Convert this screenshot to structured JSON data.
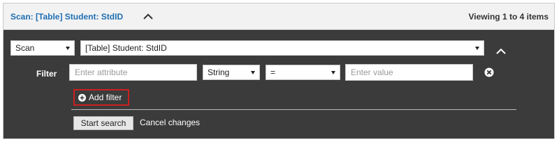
{
  "header": {
    "title": "Scan: [Table] Student: StdID",
    "viewing": "Viewing 1 to 4 items"
  },
  "query": {
    "mode": "Scan",
    "source": "[Table] Student: StdID"
  },
  "filter": {
    "label": "Filter",
    "attribute_placeholder": "Enter attribute",
    "type": "String",
    "operator": "=",
    "value_placeholder": "Enter value"
  },
  "actions": {
    "add_filter": "Add filter",
    "start_search": "Start search",
    "cancel_changes": "Cancel changes"
  },
  "colors": {
    "panel_bg": "#3b3b3b",
    "title_blue": "#1f6fb3",
    "highlight_red": "#cc1f1f"
  },
  "icons": [
    "chevron-up-icon",
    "remove-circle-icon",
    "plus-circle-icon",
    "caret-down-icon"
  ]
}
